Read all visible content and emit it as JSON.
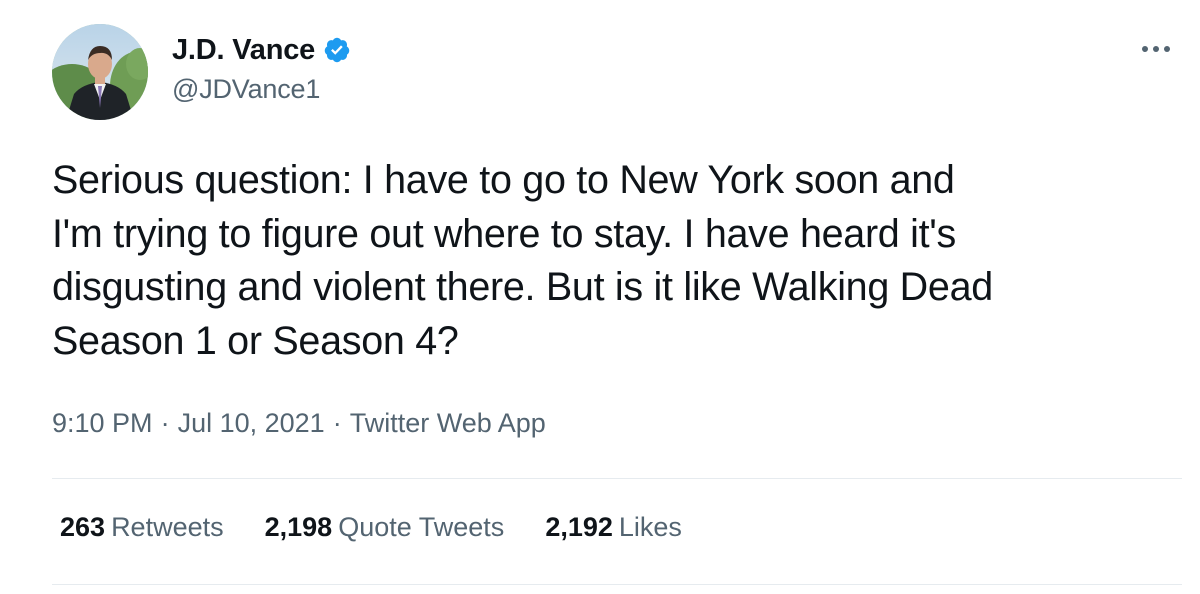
{
  "author": {
    "display_name": "J.D. Vance",
    "handle": "@JDVance1",
    "verified": true,
    "verified_color": "#1d9bf0"
  },
  "tweet": {
    "text": "Serious question: I have to go to New York soon and\nI'm trying to figure out where to stay. I have heard it's\ndisgusting and violent there. But is it like Walking Dead\nSeason 1 or Season 4?",
    "time": "9:10 PM",
    "separator": "·",
    "date": "Jul 10, 2021",
    "source": "Twitter Web App"
  },
  "stats": {
    "retweets_count": "263",
    "retweets_label": "Retweets",
    "quote_tweets_count": "2,198",
    "quote_tweets_label": "Quote Tweets",
    "likes_count": "2,192",
    "likes_label": "Likes"
  },
  "icons": {
    "more": "more-options-icon",
    "verified": "verified-badge-icon"
  },
  "colors": {
    "text_primary": "#0f1419",
    "text_secondary": "#536471",
    "divider": "#e6ebef"
  }
}
